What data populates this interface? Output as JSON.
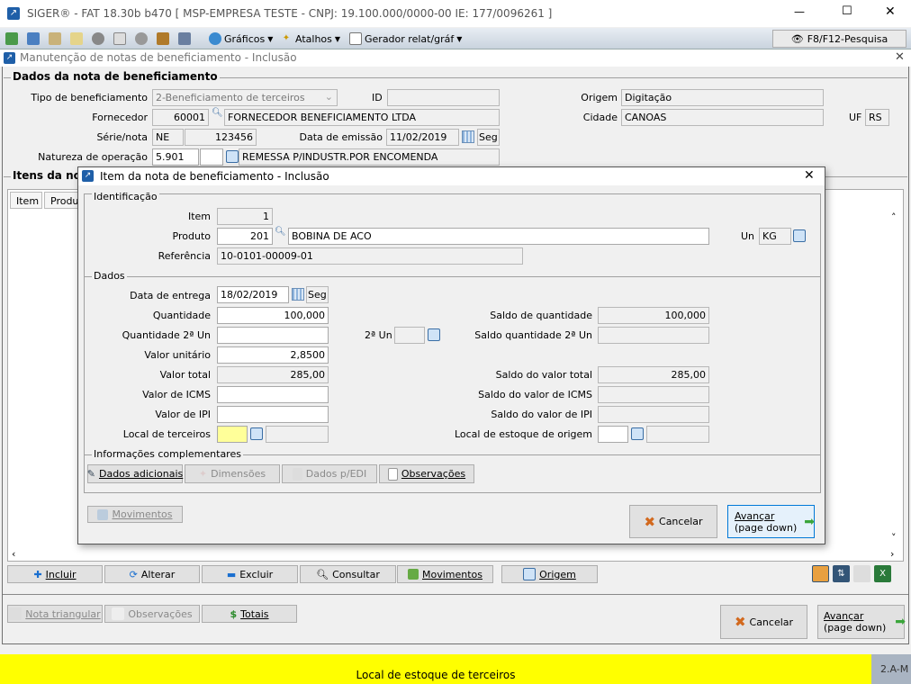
{
  "app": {
    "title": "SIGER® - FAT 18.30b b470 [ MSP-EMPRESA TESTE - CNPJ: 19.100.000/0000-00 IE: 177/0096261 ]",
    "minimize": "—",
    "maximize": "☐",
    "close": "✕"
  },
  "toolbar": {
    "graficos": "Gráficos",
    "atalhos": "Atalhos",
    "gerador": "Gerador relat/gráf",
    "pesquisa": "F8/F12-Pesquisa"
  },
  "window": {
    "title": "Manutenção de notas de beneficiamento - Inclusão",
    "close": "✕"
  },
  "nota": {
    "group": "Dados da nota de beneficiamento",
    "tipo_label": "Tipo de beneficiamento",
    "tipo": "2-Beneficiamento de terceiros",
    "id_label": "ID",
    "id": "",
    "origem_label": "Origem",
    "origem": "Digitação",
    "fornecedor_label": "Fornecedor",
    "fornecedor_cod": "60001",
    "fornecedor_nome": "FORNECEDOR BENEFICIAMENTO LTDA",
    "cidade_label": "Cidade",
    "cidade": "CANOAS",
    "uf_label": "UF",
    "uf": "RS",
    "serie_label": "Série/nota",
    "serie": "NE",
    "nota": "123456",
    "emissao_label": "Data de emissão",
    "emissao": "11/02/2019",
    "emissao_dia": "Seg",
    "natureza_label": "Natureza de operação",
    "natureza": "5.901",
    "natureza_desc": "REMESSA P/INDUSTR.POR ENCOMENDA"
  },
  "itens": {
    "group": "Itens da nota",
    "columns": [
      "Item",
      "Produto"
    ],
    "buttons": [
      "Incluir",
      "Alterar",
      "Excluir",
      "Consultar",
      "Movimentos",
      "Origem"
    ]
  },
  "footer": {
    "nota_triangular": "Nota triangular",
    "observacoes": "Observações",
    "totais": "Totais",
    "cancelar": "Cancelar",
    "avancar": "Avançar",
    "avancar2": "(page down)"
  },
  "status": {
    "message": "Local de estoque de terceiros",
    "code": "2.A-M"
  },
  "dialog": {
    "title": "Item da nota de beneficiamento - Inclusão",
    "close": "✕",
    "ident": "Identificação",
    "item_label": "Item",
    "item": "1",
    "produto_label": "Produto",
    "produto_cod": "201",
    "produto_nome": "BOBINA DE ACO",
    "un_label": "Un",
    "un": "KG",
    "ref_label": "Referência",
    "ref": "10-0101-00009-01",
    "dados": "Dados",
    "entrega_label": "Data de entrega",
    "entrega": "18/02/2019",
    "entrega_dia": "Seg",
    "qtd_label": "Quantidade",
    "qtd": "100,000",
    "saldo_qtd_label": "Saldo de quantidade",
    "saldo_qtd": "100,000",
    "qtd2_label": "Quantidade 2ª Un",
    "qtd2": "",
    "un2_label": "2ª Un",
    "un2": "",
    "saldo_qtd2_label": "Saldo quantidade 2ª Un",
    "saldo_qtd2": "",
    "vunit_label": "Valor unitário",
    "vunit": "2,8500",
    "vtotal_label": "Valor total",
    "vtotal": "285,00",
    "saldo_vtotal_label": "Saldo do valor total",
    "saldo_vtotal": "285,00",
    "icms_label": "Valor de ICMS",
    "icms": "",
    "saldo_icms_label": "Saldo do valor de ICMS",
    "saldo_icms": "",
    "ipi_label": "Valor de IPI",
    "ipi": "",
    "saldo_ipi_label": "Saldo do valor de IPI",
    "saldo_ipi": "",
    "local_label": "Local de terceiros",
    "local_origem_label": "Local de estoque de origem",
    "info": "Informações complementares",
    "b_dados": "Dados adicionais",
    "b_dim": "Dimensões",
    "b_edi": "Dados p/EDI",
    "b_obs": "Observações",
    "movimentos": "Movimentos",
    "cancelar": "Cancelar",
    "avancar": "Avançar",
    "avancar2": "(page down)"
  }
}
